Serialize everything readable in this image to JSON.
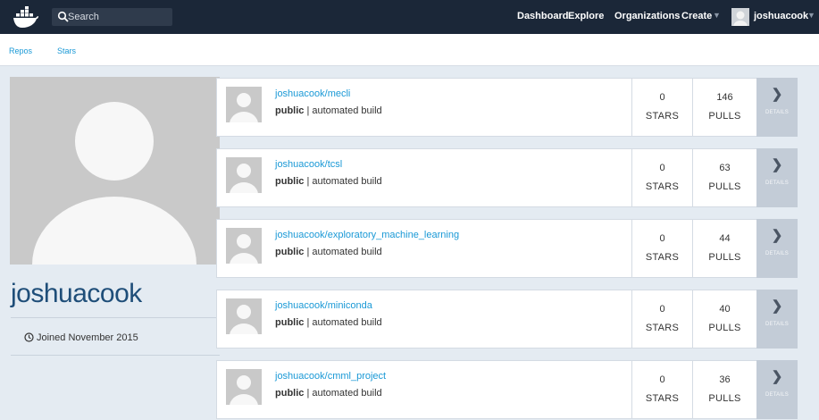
{
  "nav": {
    "search_placeholder": "Search",
    "links": [
      "Dashboard",
      "Explore",
      "Organizations",
      "Create"
    ],
    "username": "joshuacook"
  },
  "subnav": {
    "tabs": [
      "Repos",
      "Stars"
    ]
  },
  "profile": {
    "username": "joshuacook",
    "joined": "Joined November 2015"
  },
  "repos": [
    {
      "name": "joshuacook/mecli",
      "visibility": "public",
      "build": " | automated build",
      "stars": "0",
      "stars_label": "STARS",
      "pulls": "146",
      "pulls_label": "PULLS",
      "details": "DETAILS"
    },
    {
      "name": "joshuacook/tcsl",
      "visibility": "public",
      "build": " | automated build",
      "stars": "0",
      "stars_label": "STARS",
      "pulls": "63",
      "pulls_label": "PULLS",
      "details": "DETAILS"
    },
    {
      "name": "joshuacook/exploratory_machine_learning",
      "visibility": "public",
      "build": " | automated build",
      "stars": "0",
      "stars_label": "STARS",
      "pulls": "44",
      "pulls_label": "PULLS",
      "details": "DETAILS"
    },
    {
      "name": "joshuacook/miniconda",
      "visibility": "public",
      "build": " | automated build",
      "stars": "0",
      "stars_label": "STARS",
      "pulls": "40",
      "pulls_label": "PULLS",
      "details": "DETAILS"
    },
    {
      "name": "joshuacook/cmml_project",
      "visibility": "public",
      "build": " | automated build",
      "stars": "0",
      "stars_label": "STARS",
      "pulls": "36",
      "pulls_label": "PULLS",
      "details": "DETAILS"
    }
  ],
  "icons": {
    "logo": "docker-whale-icon",
    "search": "search-icon",
    "caret": "chevron-down-icon",
    "clock": "clock-icon",
    "details": "chevron-right-icon",
    "avatar": "default-avatar-icon"
  },
  "colors": {
    "nav_bg": "#1b2738",
    "link": "#1a99d6",
    "page_bg": "#e4ebf2",
    "username": "#1f4e79",
    "details_bg": "#c3ccd7"
  }
}
